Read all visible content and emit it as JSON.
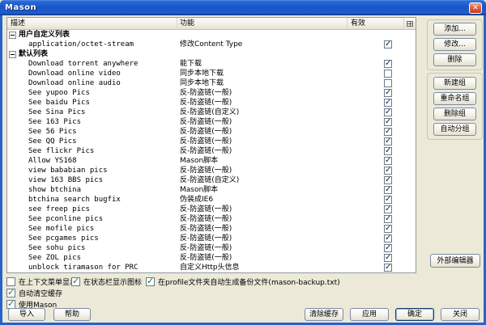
{
  "window": {
    "title": "Mason"
  },
  "icons": {
    "close": "✕"
  },
  "list": {
    "columns": [
      "描述",
      "功能",
      "有效"
    ],
    "rows": [
      {
        "type": "group",
        "label": "用户自定义列表"
      },
      {
        "type": "item",
        "desc": "application/octet-stream",
        "func": "修改Content Type",
        "checked": true
      },
      {
        "type": "group",
        "label": "默认列表"
      },
      {
        "type": "item",
        "desc": "Download torrent anywhere",
        "func": "能下载",
        "checked": true
      },
      {
        "type": "item",
        "desc": "Download online video",
        "func": "同步本地下载",
        "checked": false
      },
      {
        "type": "item",
        "desc": "Download online audio",
        "func": "同步本地下载",
        "checked": false
      },
      {
        "type": "item",
        "desc": "See yupoo Pics",
        "func": "反-防盗链(一般)",
        "checked": true
      },
      {
        "type": "item",
        "desc": "See baidu Pics",
        "func": "反-防盗链(一般)",
        "checked": true
      },
      {
        "type": "item",
        "desc": "See Sina Pics",
        "func": "反-防盗链(自定义)",
        "checked": true
      },
      {
        "type": "item",
        "desc": "See 163 Pics",
        "func": "反-防盗链(一般)",
        "checked": true
      },
      {
        "type": "item",
        "desc": "See 56 Pics",
        "func": "反-防盗链(一般)",
        "checked": true
      },
      {
        "type": "item",
        "desc": "See QQ Pics",
        "func": "反-防盗链(一般)",
        "checked": true
      },
      {
        "type": "item",
        "desc": "See flickr Pics",
        "func": "反-防盗链(一般)",
        "checked": true
      },
      {
        "type": "item",
        "desc": "Allow YS168",
        "func": "Mason脚本",
        "checked": true
      },
      {
        "type": "item",
        "desc": "view bababian pics",
        "func": "反-防盗链(一般)",
        "checked": true
      },
      {
        "type": "item",
        "desc": "view 163 BBS pics",
        "func": "反-防盗链(自定义)",
        "checked": true
      },
      {
        "type": "item",
        "desc": "show btchina",
        "func": "Mason脚本",
        "checked": true
      },
      {
        "type": "item",
        "desc": "btchina search bugfix",
        "func": "伪装成IE6",
        "checked": true
      },
      {
        "type": "item",
        "desc": "see freep pics",
        "func": "反-防盗链(一般)",
        "checked": true
      },
      {
        "type": "item",
        "desc": "See pconline pics",
        "func": "反-防盗链(一般)",
        "checked": true
      },
      {
        "type": "item",
        "desc": "See mofile pics",
        "func": "反-防盗链(一般)",
        "checked": true
      },
      {
        "type": "item",
        "desc": "See pcgames pics",
        "func": "反-防盗链(一般)",
        "checked": true
      },
      {
        "type": "item",
        "desc": "See sohu pics",
        "func": "反-防盗链(一般)",
        "checked": true
      },
      {
        "type": "item",
        "desc": "See ZOL pics",
        "func": "反-防盗链(一般)",
        "checked": true
      },
      {
        "type": "item",
        "desc": "unblock tiramason for PRC",
        "func": "自定义Http头信息",
        "checked": true
      }
    ]
  },
  "side_buttons": {
    "add": "添加...",
    "modify": "修改...",
    "remove": "删除",
    "new_group": "新建组",
    "rename_group": "重命名组",
    "delete_group": "删除组",
    "auto_group": "自动分组",
    "external_editor": "外部编辑器"
  },
  "options": [
    {
      "label": "在上下文菜单显示",
      "checked": false
    },
    {
      "label": "在状态栏显示图标",
      "checked": true
    },
    {
      "label": "在profile文件夹自动生成备份文件(mason-backup.txt)",
      "checked": true
    },
    {
      "label": "自动清空缓存",
      "checked": true
    },
    {
      "label": "使用Mason",
      "checked": true
    }
  ],
  "bottom_buttons": {
    "import": "导入",
    "help": "帮助",
    "clear_cache": "清除缓存",
    "apply": "应用",
    "ok": "确定",
    "close": "关闭"
  }
}
